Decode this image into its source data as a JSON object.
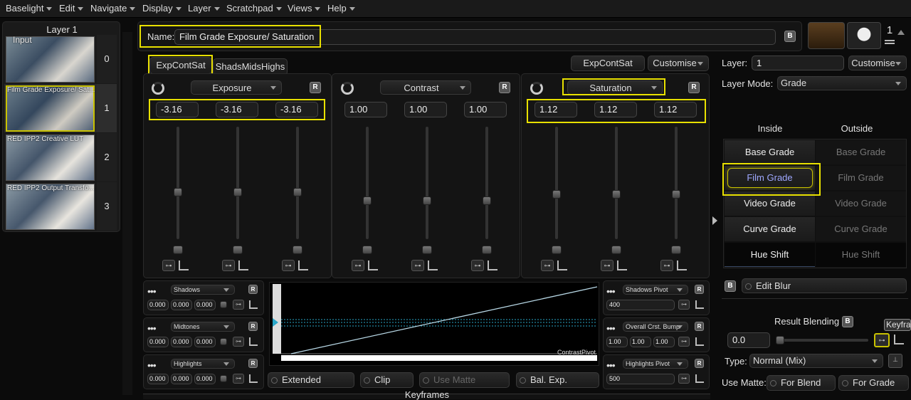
{
  "menu": [
    "Baselight",
    "Edit",
    "Navigate",
    "Display",
    "Layer",
    "Scratchpad",
    "Views",
    "Help"
  ],
  "layers_panel": {
    "title": "Layer 1",
    "items": [
      {
        "label": "Input",
        "number": "0"
      },
      {
        "label": "Film Grade Exposure/ Sat...",
        "number": "1"
      },
      {
        "label": "RED IPP2 Creative LUT",
        "number": "2"
      },
      {
        "label": "RED IPP2 Output Transfo...",
        "number": "3"
      }
    ]
  },
  "name_bar": {
    "label": "Name:",
    "value": "Film Grade Exposure/ Saturation",
    "b_button": "B"
  },
  "top_right": {
    "counter": "1"
  },
  "tabs": [
    "ExpContSat",
    "ShadsMidsHighs"
  ],
  "header_buttons": {
    "preset": "ExpContSat",
    "customise": "Customise"
  },
  "columns": [
    {
      "title": "Exposure",
      "values": [
        "-3.16",
        "-3.16",
        "-3.16"
      ],
      "knob_pos": [
        0.58,
        0.58,
        0.58
      ]
    },
    {
      "title": "Contrast",
      "values": [
        "1.00",
        "1.00",
        "1.00"
      ],
      "knob_pos": [
        0.66,
        0.66,
        0.66
      ]
    },
    {
      "title": "Saturation",
      "values": [
        "1.12",
        "1.12",
        "1.12"
      ],
      "knob_pos": [
        0.6,
        0.6,
        0.6
      ]
    }
  ],
  "r_label": "R",
  "left_bands": [
    {
      "title": "Shadows",
      "values": [
        "0.000",
        "0.000",
        "0.000"
      ]
    },
    {
      "title": "Midtones",
      "values": [
        "0.000",
        "0.000",
        "0.000"
      ]
    },
    {
      "title": "Highlights",
      "values": [
        "0.000",
        "0.000",
        "0.000"
      ]
    }
  ],
  "right_bands": [
    {
      "title": "Shadows Pivot",
      "values": [
        "400"
      ]
    },
    {
      "title": "Overall Crst. Bump",
      "values": [
        "1.00",
        "1.00",
        "1.00"
      ]
    },
    {
      "title": "Highlights Pivot",
      "values": [
        "500"
      ]
    }
  ],
  "curve": {
    "pivot_label": "ContrastPivot"
  },
  "bottom_buttons": [
    "Extended",
    "Clip",
    "Use Matte",
    "Bal. Exp."
  ],
  "footer": "Keyframes",
  "right_panel": {
    "layer_label": "Layer:",
    "layer_value": "1",
    "customise": "Customise",
    "mode_label": "Layer Mode:",
    "mode_value": "Grade",
    "inside": "Inside",
    "outside": "Outside",
    "grades": [
      "Base Grade",
      "Film Grade",
      "Video Grade",
      "Curve Grade",
      "Hue Shift"
    ],
    "b_label": "B",
    "edit_blur": "Edit Blur",
    "result_blending": "Result Blending",
    "blend_value": "0.0",
    "keyframe_tip": "Keyfra",
    "type_label": "Type:",
    "type_value": "Normal (Mix)",
    "use_matte": "Use Matte:",
    "for_blend": "For Blend",
    "for_grade": "For Grade"
  }
}
